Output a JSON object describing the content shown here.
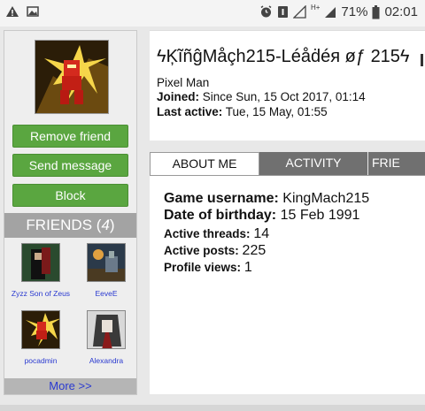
{
  "status_bar": {
    "battery_percent": "71%",
    "time": "02:01",
    "network": "H+"
  },
  "profile": {
    "display_name": "ϟĶĩñĝMåçh215-Léåḋéя øƒ 215ϟ",
    "subtitle": "Pixel Man",
    "joined_label": "Joined:",
    "joined_value": " Since Sun, 15 Oct 2017, 01:14",
    "last_active_label": "Last active:",
    "last_active_value": " Tue, 15 May, 01:55"
  },
  "actions": {
    "remove_friend": "Remove friend",
    "send_message": "Send message",
    "block": "Block"
  },
  "friends": {
    "header_label": "FRIENDS",
    "count": "4",
    "items": [
      {
        "name": "Zyzz Son of Zeus"
      },
      {
        "name": "EeveE"
      },
      {
        "name": "pocadmin"
      },
      {
        "name": "Alexandra"
      }
    ],
    "more_label": "More >>"
  },
  "tabs": {
    "about": "ABOUT ME",
    "activity": "ACTIVITY",
    "friends": "FRIE"
  },
  "about": {
    "game_username_label": "Game username:",
    "game_username_value": " KingMach215",
    "birthday_label": "Date of birthday:",
    "birthday_value": " 15 Feb 1991",
    "threads_label": "Active threads:",
    "threads_value": "14",
    "posts_label": "Active posts:",
    "posts_value": "225",
    "views_label": "Profile views:",
    "views_value": "1"
  }
}
